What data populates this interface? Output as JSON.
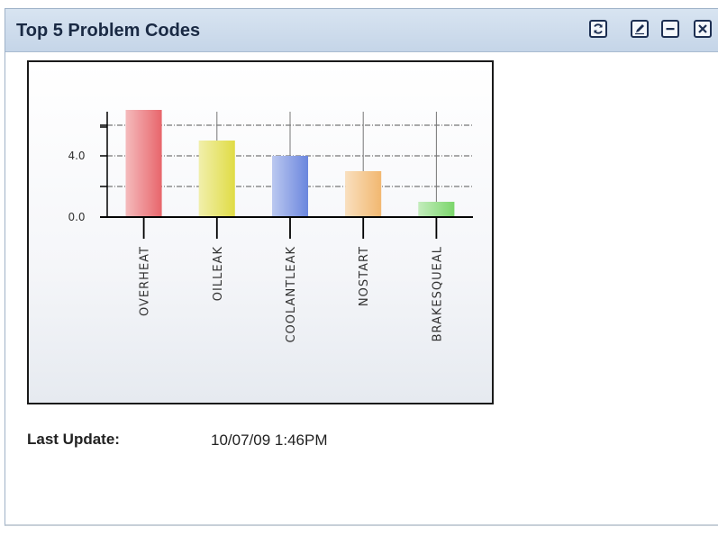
{
  "pagelet": {
    "title": "Top 5 Problem Codes",
    "buttons": [
      {
        "name": "refresh-button",
        "icon": "refresh-icon"
      },
      {
        "name": "edit-button",
        "icon": "edit-icon"
      },
      {
        "name": "minimize-button",
        "icon": "minimize-icon"
      },
      {
        "name": "close-button",
        "icon": "close-icon"
      }
    ]
  },
  "chart_data": {
    "type": "bar",
    "categories": [
      "OVERHEAT",
      "OILLEAK",
      "COOLANTLEAK",
      "NOSTART",
      "BRAKESQUEAL"
    ],
    "values": [
      7,
      5,
      4,
      3,
      1
    ],
    "colors": [
      "#e8666b",
      "#e0dc45",
      "#6a86de",
      "#f2b870",
      "#7bd66b"
    ],
    "y_tick_labels": [
      "4.0",
      "0.0"
    ],
    "y_major_ticks": [
      0,
      4
    ],
    "y_gridlines": [
      2,
      4,
      6
    ],
    "ylim": [
      0,
      7
    ],
    "title": "",
    "xlabel": "",
    "ylabel": "",
    "grid": true
  },
  "footer": {
    "last_update_label": "Last Update:",
    "last_update_value": "10/07/09  1:46PM"
  }
}
